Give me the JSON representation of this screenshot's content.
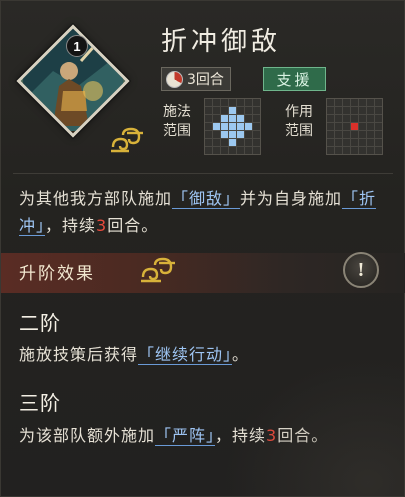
{
  "skill": {
    "level": "1",
    "name": "折冲御敌",
    "cooldown_text": "3回合",
    "type_badge": "支援",
    "cast_range_label": "施法\n范围",
    "effect_range_label": "作用\n范围"
  },
  "description": {
    "part1": "为其他我方部队施加",
    "kw1": "「御敌」",
    "part2": "并为自身施加",
    "kw2": "「折冲」",
    "part3": "，持续",
    "turns": "3",
    "part4": "回合。"
  },
  "upgrade": {
    "title": "升阶效果",
    "tier2": {
      "title": "二阶",
      "part1": "施放技策后获得",
      "kw": "「继续行动」",
      "part2": "。"
    },
    "tier3": {
      "title": "三阶",
      "part1": "为该部队额外施加",
      "kw": "「严阵」",
      "part2": "，持续",
      "turns": "3",
      "part3": "回合。"
    }
  },
  "colors": {
    "keyword": "#9ec5f3",
    "number": "#e64a3c",
    "support_badge": "#2f6b4a",
    "cast_range_cell": "#9cc8f0",
    "effect_range_cell": "#d9302a"
  },
  "icons": [
    "info-icon",
    "cloud-emblem-icon",
    "cooldown-pie-icon"
  ]
}
